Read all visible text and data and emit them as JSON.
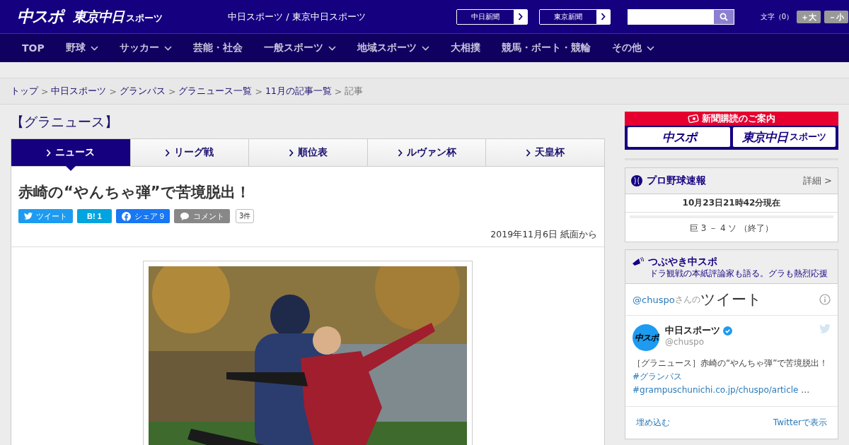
{
  "header": {
    "logo_main": "中スポ",
    "logo_sub": "東京中日",
    "logo_sub_small": "スポーツ",
    "site_title": "中日スポーツ / 東京中日スポーツ",
    "links": [
      {
        "label": "中日新聞"
      },
      {
        "label": "東京新聞"
      }
    ],
    "font_size_label": "文字（0）",
    "font_buttons": [
      "＋大",
      "－小"
    ]
  },
  "nav": [
    {
      "label": "TOP",
      "dropdown": false
    },
    {
      "label": "野球",
      "dropdown": true
    },
    {
      "label": "サッカー",
      "dropdown": true
    },
    {
      "label": "芸能・社会",
      "dropdown": false
    },
    {
      "label": "一般スポーツ",
      "dropdown": true
    },
    {
      "label": "地域スポーツ",
      "dropdown": true
    },
    {
      "label": "大相撲",
      "dropdown": false
    },
    {
      "label": "競馬・ボート・競輪",
      "dropdown": false
    },
    {
      "label": "その他",
      "dropdown": true
    }
  ],
  "breadcrumb": {
    "separator": ">",
    "items": [
      {
        "label": "トップ",
        "link": true
      },
      {
        "label": "中日スポーツ",
        "link": true
      },
      {
        "label": "グランパス",
        "link": true
      },
      {
        "label": "グラニュース一覧",
        "link": true
      },
      {
        "label": "11月の記事一覧",
        "link": true
      },
      {
        "label": "記事",
        "link": false
      }
    ]
  },
  "section_title": "【グラニュース】",
  "tabs": [
    {
      "label": "ニュース",
      "selected": true
    },
    {
      "label": "リーグ戦",
      "selected": false
    },
    {
      "label": "順位表",
      "selected": false
    },
    {
      "label": "ルヴァン杯",
      "selected": false
    },
    {
      "label": "天皇杯",
      "selected": false
    }
  ],
  "article": {
    "title": "赤崎の“やんちゃ弾”で苦境脱出！",
    "share": [
      {
        "kind": "twitter",
        "label": "ツイート"
      },
      {
        "kind": "hatena",
        "label": "B!",
        "count": "1"
      },
      {
        "kind": "facebook",
        "label": "シェア",
        "count": "9"
      },
      {
        "kind": "comment",
        "label": "コメント",
        "count": "3件"
      }
    ],
    "date": "2019年11月6日 紙面から"
  },
  "sidebar": {
    "subscribe": {
      "title": "新聞購読のご案内",
      "logos": [
        {
          "main": "中スポ"
        },
        {
          "main": "東京中日",
          "small": "スポーツ"
        }
      ]
    },
    "scores": {
      "title": "プロ野球速報",
      "more": "詳細 >",
      "updated": "10月23日21時42分現在",
      "games": [
        "巨 3 － 4 ソ （終了）"
      ]
    },
    "tweets": {
      "title": "つぶやき中スポ",
      "subtitle": "ドラ観戦の本紙評論家も語る。グラも熱烈応援",
      "handle": "@chuspo",
      "handle_suffix": "さんの",
      "heading": "ツイート",
      "tweet": {
        "avatar_text": "中スポ",
        "name": "中日スポーツ",
        "verified": true,
        "handle": "@chuspo",
        "segments": [
          {
            "text": "［グラニュース］赤崎の“やんちゃ弾”で苦境脱出！",
            "link": false
          },
          {
            "text": "#グランパス",
            "link": true
          },
          {
            "text": "#grampuschunichi.co.jp/chuspo/article",
            "link": true
          },
          {
            "text": "…",
            "link": false
          }
        ]
      },
      "footer": [
        "埋め込む",
        "Twitterで表示"
      ]
    }
  }
}
